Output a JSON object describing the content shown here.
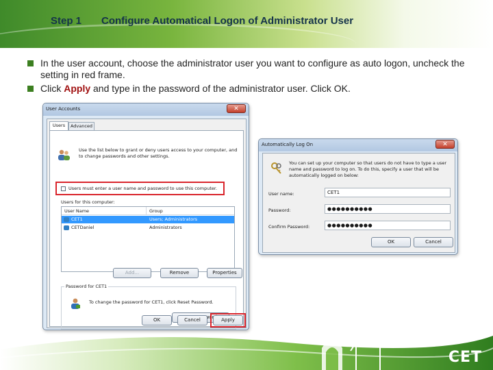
{
  "slide": {
    "step": "Step 1",
    "title": "Configure Automatical Logon of Administrator User",
    "bullets": [
      {
        "text": "In the user account, choose the administrator user you want to configure as auto logon, uncheck the setting in red frame."
      },
      {
        "before": "Click ",
        "highlight": "Apply",
        "after": " and type in the password of the administrator user. Click OK."
      }
    ],
    "logo_text": "CET"
  },
  "user_accounts_dialog": {
    "title": "User Accounts",
    "tabs": [
      "Users",
      "Advanced"
    ],
    "intro": "Use the list below to grant or deny users access to your computer, and to change passwords and other settings.",
    "checkbox_label": "Users must enter a user name and password to use this computer.",
    "checkbox_checked": false,
    "list_caption": "Users for this computer:",
    "columns": [
      "User Name",
      "Group"
    ],
    "rows": [
      {
        "name": "CET1",
        "group": "Users; Administrators",
        "selected": true
      },
      {
        "name": "CETDaniel",
        "group": "Administrators",
        "selected": false
      }
    ],
    "buttons": {
      "add": "Add...",
      "remove": "Remove",
      "properties": "Properties"
    },
    "password_group_label": "Password for CET1",
    "password_text": "To change the password for CET1, click Reset Password.",
    "reset_password": "Reset Password...",
    "ok": "OK",
    "cancel": "Cancel",
    "apply": "Apply"
  },
  "auto_logon_dialog": {
    "title": "Automatically Log On",
    "intro": "You can set up your computer so that users do not have to type a user name and password to log on. To do this, specify a user that will be automatically logged on below:",
    "user_name_label": "User name:",
    "user_name_value": "CET1",
    "password_label": "Password:",
    "password_value": "●●●●●●●●●●",
    "confirm_password_label": "Confirm Password:",
    "confirm_password_value": "●●●●●●●●●●",
    "ok": "OK",
    "cancel": "Cancel"
  },
  "colors": {
    "highlight_frame": "#d9242b",
    "accent_green": "#3c7f20",
    "title_text": "#14324a",
    "selection": "#3399ff"
  },
  "icons": [
    "users-icon",
    "user-row-icon",
    "password-user-icon",
    "keys-icon",
    "close-icon",
    "wind-turbine-icon"
  ]
}
